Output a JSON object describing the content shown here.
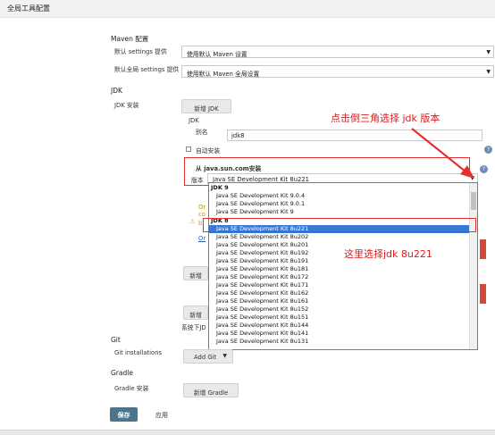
{
  "header": {
    "title": "全局工具配置"
  },
  "maven": {
    "section_title": "Maven 配置",
    "settings_label": "默认 settings 提供",
    "settings_value": "使用默认 Maven 设置",
    "global_settings_label": "默认全局 settings 提供",
    "global_settings_value": "使用默认 Maven 全局设置"
  },
  "jdk": {
    "section_title": "JDK",
    "install_label": "JDK 安装",
    "add_button": "新增 JDK",
    "jdk_heading": "JDK",
    "alias_label": "别名",
    "alias_value": "jdk8",
    "auto_install_label": "自动安装",
    "installer_title": "从 java.sun.com安装",
    "version_label": "版本",
    "version_value": "Java SE Development Kit 8u221",
    "partial_texts": [
      "Or",
      "co",
      "b",
      "Or"
    ],
    "add_installer_button_1": "新增",
    "add_installer_button_2": "新增",
    "system_note": "系统下JD"
  },
  "dropdown": {
    "groups": [
      {
        "label": "JDK 9",
        "items": [
          "Java SE Development Kit 9.0.4",
          "Java SE Development Kit 9.0.1",
          "Java SE Development Kit 9"
        ]
      },
      {
        "label": "JDK 8",
        "items": [
          "Java SE Development Kit 8u221",
          "Java SE Development Kit 8u202",
          "Java SE Development Kit 8u201",
          "Java SE Development Kit 8u192",
          "Java SE Development Kit 8u191",
          "Java SE Development Kit 8u181",
          "Java SE Development Kit 8u172",
          "Java SE Development Kit 8u171",
          "Java SE Development Kit 8u162",
          "Java SE Development Kit 8u161",
          "Java SE Development Kit 8u152",
          "Java SE Development Kit 8u151",
          "Java SE Development Kit 8u144",
          "Java SE Development Kit 8u141",
          "Java SE Development Kit 8u131"
        ]
      }
    ],
    "selected": "Java SE Development Kit 8u221"
  },
  "annotations": {
    "note_top": "点击倒三角选择 jdk 版本",
    "note_list": "这里选择jdk 8u221"
  },
  "git": {
    "section_title": "Git",
    "installations_label": "Git installations",
    "add_button": "Add Git"
  },
  "gradle": {
    "section_title": "Gradle",
    "install_label": "Gradle 安装",
    "add_button": "新增 Gradle"
  },
  "footer": {
    "save_button": "保存",
    "apply_button": "应用"
  },
  "icons": {
    "help": "help-icon",
    "warning": "warning-icon",
    "dropdown_arrow": "chevron-down-icon"
  },
  "colors": {
    "annotation_red": "#e53030",
    "save_button_bg": "#4b758b",
    "selected_row": "#3a78d6"
  }
}
